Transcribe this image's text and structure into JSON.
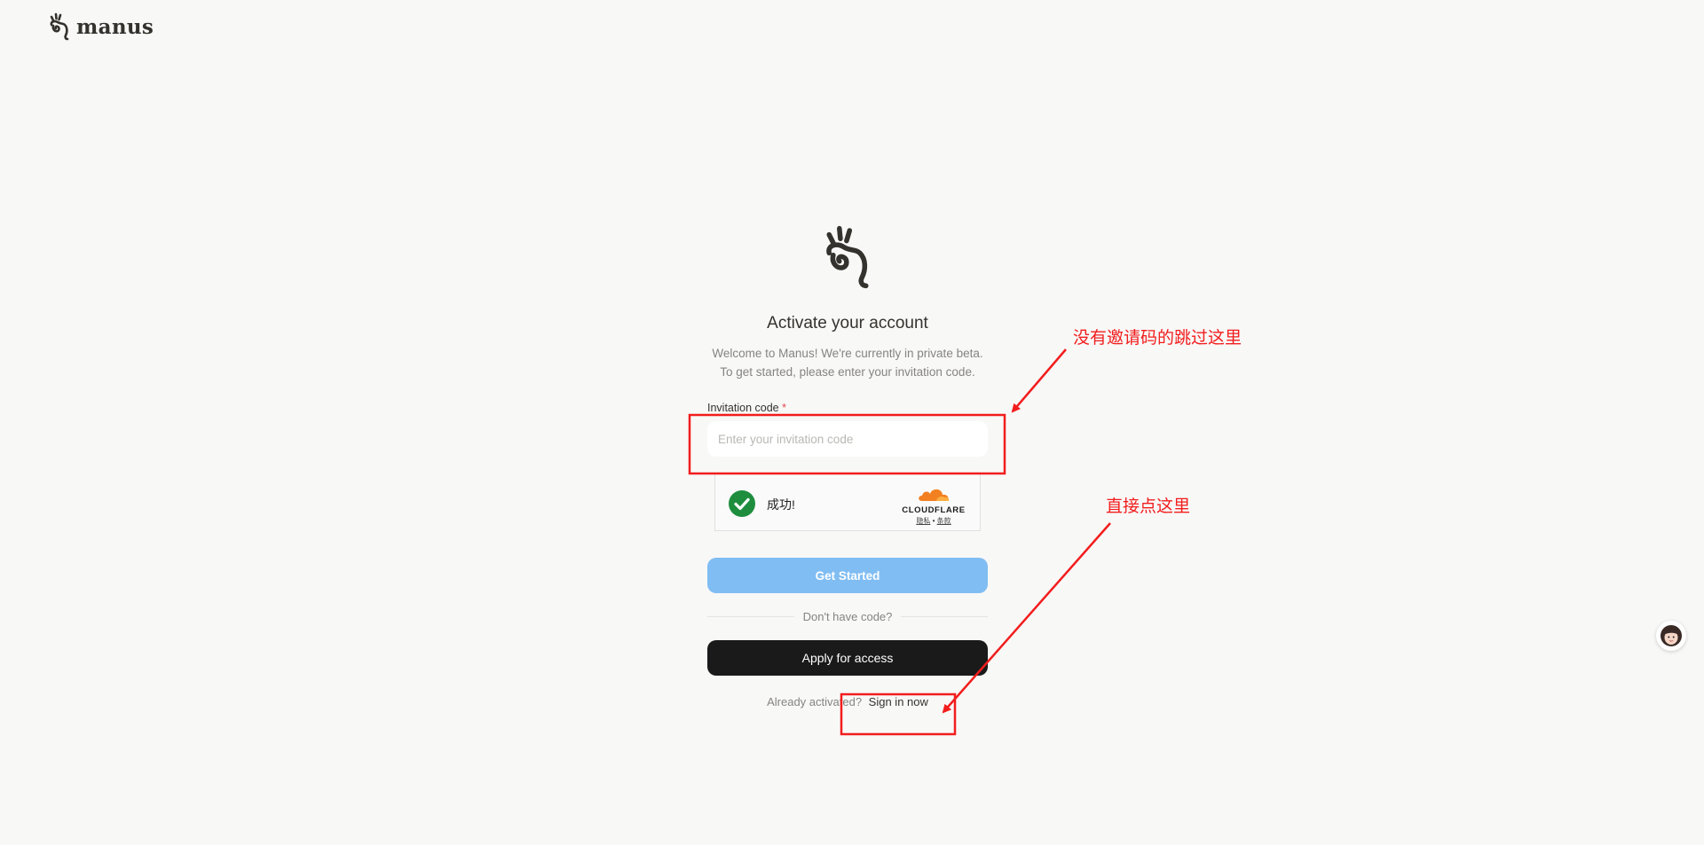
{
  "brand": {
    "name": "manus",
    "logo_icon": "manus-hand-icon"
  },
  "activation": {
    "title": "Activate your account",
    "subtitle_line1": "Welcome to Manus! We're currently in private beta.",
    "subtitle_line2": "To get started, please enter your invitation code.",
    "field_label": "Invitation code",
    "required_mark": "*",
    "input_placeholder": "Enter your invitation code",
    "input_value": "",
    "captcha": {
      "status": "成功!",
      "provider": "CLOUDFLARE",
      "privacy_link": "隐私",
      "separator": "•",
      "terms_link": "条款"
    },
    "get_started_label": "Get Started",
    "divider_text": "Don't have code?",
    "apply_label": "Apply for access",
    "signin_prompt": "Already activated?",
    "signin_link": "Sign in now"
  },
  "annotations": {
    "note_skip": "没有邀请码的跳过这里",
    "note_click": "直接点这里",
    "color": "#f21d1d"
  },
  "colors": {
    "background": "#f8f8f7",
    "primary_disabled": "#80bdf3",
    "dark_button": "#1a1a1a",
    "success_green": "#1e8e3e",
    "cloudflare_orange": "#f38020"
  }
}
